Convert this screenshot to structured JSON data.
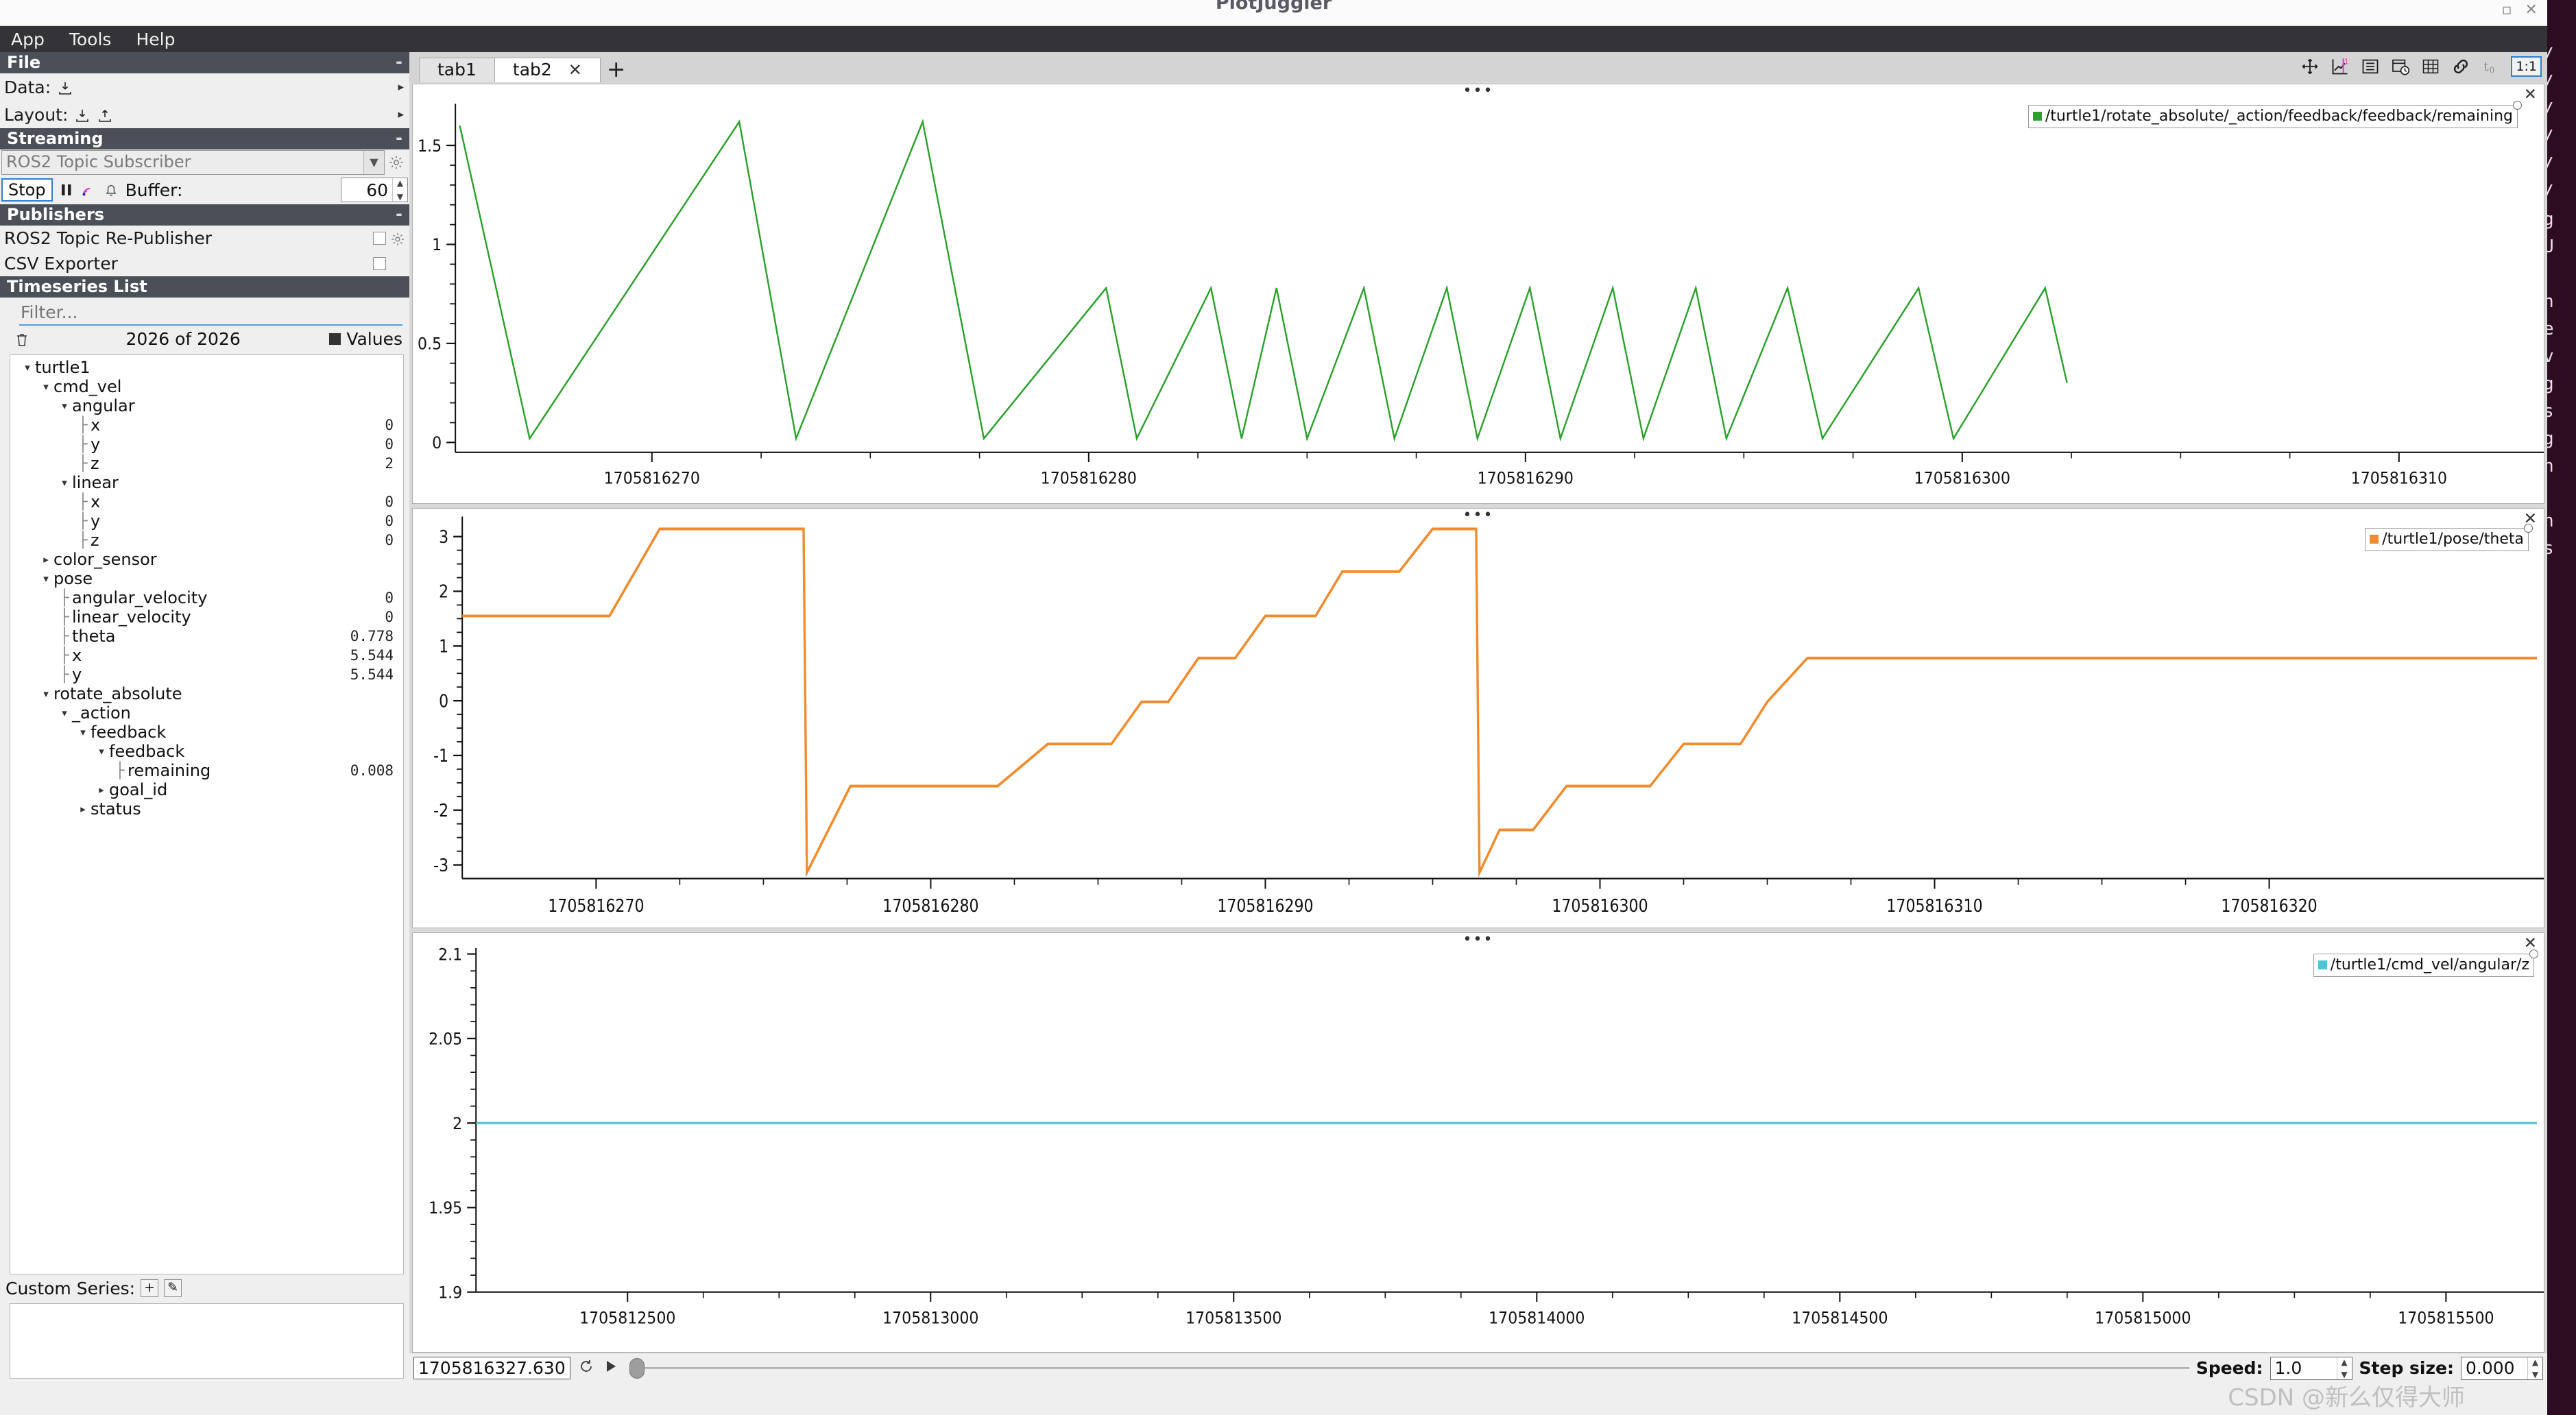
{
  "window": {
    "title": "PlotJuggler",
    "controls": "▫ ✕"
  },
  "menubar": {
    "items": [
      "App",
      "Tools",
      "Help"
    ]
  },
  "sidebar": {
    "file_section": {
      "header": "File",
      "collapse": "-",
      "data_label": "Data:",
      "data_icon": "import-icon",
      "layout_label": "Layout:",
      "layout_icon_import": "import-icon",
      "layout_icon_export": "export-icon",
      "arrow": "▸"
    },
    "streaming_section": {
      "header": "Streaming",
      "collapse": "-",
      "selected_plugin": "ROS2 Topic Subscriber",
      "gear_icon": "gear-icon",
      "stop_label": "Stop",
      "pause_icon": "pause-icon",
      "wifi_icon": "signal-icon",
      "bell_icon": "bell-icon",
      "buffer_label": "Buffer:",
      "buffer_value": "60"
    },
    "publishers_section": {
      "header": "Publishers",
      "collapse": "-",
      "items": [
        {
          "label": "ROS2 Topic Re-Publisher",
          "checked": false,
          "has_gear": true
        },
        {
          "label": "CSV Exporter",
          "checked": false,
          "has_gear": false
        }
      ]
    },
    "timeseries_section": {
      "header": "Timeseries List",
      "filter_placeholder": "Filter...",
      "trash_icon": "trash-icon",
      "count_text": "2026 of 2026",
      "values_label": "Values"
    },
    "tree": [
      {
        "depth": 0,
        "tri": "▾",
        "label": "turtle1",
        "value": ""
      },
      {
        "depth": 1,
        "tri": "▾",
        "label": "cmd_vel",
        "value": ""
      },
      {
        "depth": 2,
        "tri": "▾",
        "label": "angular",
        "value": ""
      },
      {
        "depth": 3,
        "tri": "",
        "label": "x",
        "value": "0"
      },
      {
        "depth": 3,
        "tri": "",
        "label": "y",
        "value": "0"
      },
      {
        "depth": 3,
        "tri": "",
        "label": "z",
        "value": "2"
      },
      {
        "depth": 2,
        "tri": "▾",
        "label": "linear",
        "value": ""
      },
      {
        "depth": 3,
        "tri": "",
        "label": "x",
        "value": "0"
      },
      {
        "depth": 3,
        "tri": "",
        "label": "y",
        "value": "0"
      },
      {
        "depth": 3,
        "tri": "",
        "label": "z",
        "value": "0"
      },
      {
        "depth": 1,
        "tri": "▸",
        "label": "color_sensor",
        "value": ""
      },
      {
        "depth": 1,
        "tri": "▾",
        "label": "pose",
        "value": ""
      },
      {
        "depth": 2,
        "tri": "",
        "label": "angular_velocity",
        "value": "0"
      },
      {
        "depth": 2,
        "tri": "",
        "label": "linear_velocity",
        "value": "0"
      },
      {
        "depth": 2,
        "tri": "",
        "label": "theta",
        "value": "0.778"
      },
      {
        "depth": 2,
        "tri": "",
        "label": "x",
        "value": "5.544"
      },
      {
        "depth": 2,
        "tri": "",
        "label": "y",
        "value": "5.544"
      },
      {
        "depth": 1,
        "tri": "▾",
        "label": "rotate_absolute",
        "value": ""
      },
      {
        "depth": 2,
        "tri": "▾",
        "label": "_action",
        "value": ""
      },
      {
        "depth": 3,
        "tri": "▾",
        "label": "feedback",
        "value": ""
      },
      {
        "depth": 4,
        "tri": "▾",
        "label": "feedback",
        "value": ""
      },
      {
        "depth": 5,
        "tri": "",
        "label": "remaining",
        "value": "0.008"
      },
      {
        "depth": 4,
        "tri": "▸",
        "label": "goal_id",
        "value": ""
      },
      {
        "depth": 3,
        "tri": "▸",
        "label": "status",
        "value": ""
      }
    ],
    "custom_series": {
      "label": "Custom Series:",
      "add_label": "+",
      "edit_label": "✎"
    }
  },
  "tabs": {
    "items": [
      {
        "label": "tab1",
        "active": false,
        "closable": false
      },
      {
        "label": "tab2",
        "active": true,
        "closable": true
      }
    ],
    "close_glyph": "✕",
    "add_label": "+"
  },
  "toolbar": {
    "icons": [
      "move-icon",
      "zoom-chart-icon",
      "list-icon",
      "calendar-clock-icon",
      "grid-icon",
      "link-icon",
      "t-zero-icon"
    ],
    "ratio_label": "1:1"
  },
  "plots": [
    {
      "name": "plot-remaining",
      "dots": "•••",
      "close": "✕",
      "legend": "/turtle1/rotate_absolute/_action/feedback/feedback/remaining",
      "color": "#2ca02c"
    },
    {
      "name": "plot-theta",
      "dots": "•••",
      "close": "✕",
      "legend": "/turtle1/pose/theta",
      "color": "#f08c2e"
    },
    {
      "name": "plot-angular-z",
      "dots": "•••",
      "close": "✕",
      "legend": "/turtle1/cmd_vel/angular/z",
      "color": "#4fc3d9"
    }
  ],
  "bottom": {
    "time_value": "1705816327.630",
    "reload_icon": "reload-icon",
    "play_icon": "play-icon",
    "speed_label": "Speed:",
    "speed_value": "1.0",
    "step_label": "Step size:",
    "step_value": "0.000",
    "watermark": "CSDN @新么仅得大师"
  },
  "chart_data": [
    {
      "type": "line",
      "name": "remaining",
      "title": "/turtle1/rotate_absolute/_action/feedback/feedback/remaining",
      "color": "#2ca02c",
      "xlabel": "",
      "ylabel": "",
      "xlim": [
        1705816265.5,
        1705816313.0
      ],
      "ylim": [
        -0.05,
        1.68
      ],
      "xticks": [
        1705816270,
        1705816280,
        1705816290,
        1705816300,
        1705816310
      ],
      "yticks": [
        0,
        0.5,
        1,
        1.5
      ],
      "grid": false,
      "legend_position": "top-right",
      "description": "Sawtooth: three large ramps peaking ~1.6 then repeated small ramps peaking ~0.78",
      "points": [
        [
          1705816265.6,
          1.6
        ],
        [
          1705816267.2,
          0.02
        ],
        [
          1705816272.0,
          1.62
        ],
        [
          1705816273.3,
          0.02
        ],
        [
          1705816276.2,
          1.62
        ],
        [
          1705816277.6,
          0.02
        ],
        [
          1705816280.4,
          0.78
        ],
        [
          1705816281.1,
          0.02
        ],
        [
          1705816282.8,
          0.78
        ],
        [
          1705816283.5,
          0.02
        ],
        [
          1705816284.3,
          0.78
        ],
        [
          1705816285.0,
          0.02
        ],
        [
          1705816286.3,
          0.78
        ],
        [
          1705816287.0,
          0.02
        ],
        [
          1705816288.2,
          0.78
        ],
        [
          1705816288.9,
          0.02
        ],
        [
          1705816290.1,
          0.78
        ],
        [
          1705816290.8,
          0.02
        ],
        [
          1705816292.0,
          0.78
        ],
        [
          1705816292.7,
          0.02
        ],
        [
          1705816293.9,
          0.78
        ],
        [
          1705816294.6,
          0.02
        ],
        [
          1705816296.0,
          0.78
        ],
        [
          1705816296.8,
          0.02
        ],
        [
          1705816299.0,
          0.78
        ],
        [
          1705816299.8,
          0.02
        ],
        [
          1705816301.9,
          0.78
        ],
        [
          1705816302.4,
          0.3
        ]
      ]
    },
    {
      "type": "line",
      "name": "theta",
      "title": "/turtle1/pose/theta",
      "color": "#f08c2e",
      "xlabel": "",
      "ylabel": "",
      "xlim": [
        1705816266.0,
        1705816328.0
      ],
      "ylim": [
        -3.25,
        3.25
      ],
      "xticks": [
        1705816270,
        1705816280,
        1705816290,
        1705816300,
        1705816310,
        1705816320
      ],
      "yticks": [
        -3,
        -2,
        -1,
        0,
        1,
        2,
        3
      ],
      "grid": false,
      "legend_position": "top-right",
      "description": "Staircase of robot heading: holds 1.55, jumps to 3.14, wraps to -3.14, climbs in steps",
      "points": [
        [
          1705816266.0,
          1.55
        ],
        [
          1705816270.4,
          1.55
        ],
        [
          1705816271.9,
          3.14
        ],
        [
          1705816276.2,
          3.14
        ],
        [
          1705816276.3,
          -3.14
        ],
        [
          1705816277.6,
          -1.56
        ],
        [
          1705816282.0,
          -1.56
        ],
        [
          1705816283.5,
          -0.79
        ],
        [
          1705816285.4,
          -0.79
        ],
        [
          1705816286.3,
          -0.02
        ],
        [
          1705816287.1,
          -0.02
        ],
        [
          1705816288.0,
          0.78
        ],
        [
          1705816289.1,
          0.78
        ],
        [
          1705816290.0,
          1.55
        ],
        [
          1705816291.5,
          1.55
        ],
        [
          1705816292.3,
          2.36
        ],
        [
          1705816294.0,
          2.36
        ],
        [
          1705816295.0,
          3.14
        ],
        [
          1705816296.3,
          3.14
        ],
        [
          1705816296.4,
          -3.14
        ],
        [
          1705816297.0,
          -2.36
        ],
        [
          1705816298.0,
          -2.36
        ],
        [
          1705816299.0,
          -1.56
        ],
        [
          1705816301.5,
          -1.56
        ],
        [
          1705816302.5,
          -0.79
        ],
        [
          1705816304.2,
          -0.79
        ],
        [
          1705816305.0,
          -0.02
        ],
        [
          1705816306.2,
          0.78
        ],
        [
          1705816328.0,
          0.78
        ]
      ]
    },
    {
      "type": "line",
      "name": "angular_z",
      "title": "/turtle1/cmd_vel/angular/z",
      "color": "#4fc3d9",
      "xlabel": "",
      "ylabel": "",
      "xlim": [
        1705812250,
        1705815650
      ],
      "ylim": [
        1.9,
        2.1
      ],
      "xticks": [
        1705812500,
        1705813000,
        1705813500,
        1705814000,
        1705814500,
        1705815000,
        1705815500
      ],
      "yticks": [
        1.9,
        1.95,
        2,
        2.05,
        2.1
      ],
      "grid": false,
      "legend_position": "top-right",
      "description": "Constant angular velocity command at 2.0",
      "points": [
        [
          1705812250,
          2.0
        ],
        [
          1705815650,
          2.0
        ]
      ]
    }
  ]
}
